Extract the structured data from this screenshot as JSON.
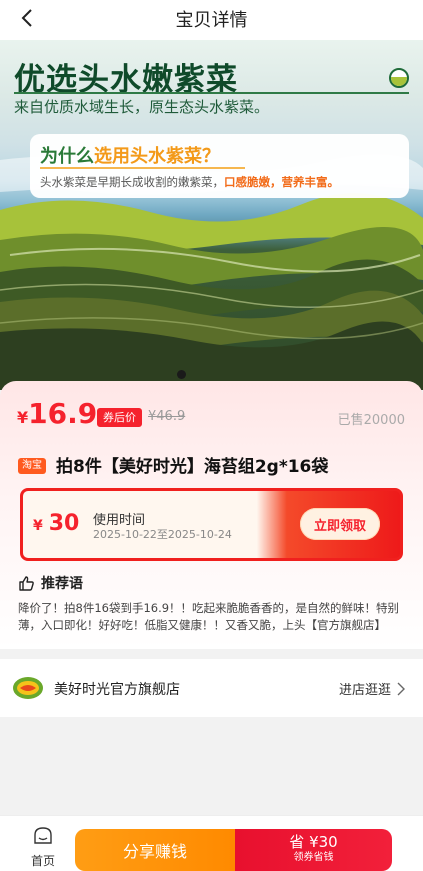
{
  "nav": {
    "title": "宝贝详情",
    "back_icon": "chevron-left-icon"
  },
  "hero": {
    "title": "优选头水嫩紫菜",
    "subtitle": "来自优质水域生长，原生态头水紫菜。",
    "question_a": "为什么",
    "question_b": "选用头水紫菜？",
    "desc_a": "头水紫菜是早期长成收割的嫩紫菜，",
    "desc_b": "口感脆嫩，营养丰富。"
  },
  "product": {
    "currency": "¥",
    "price": "16.9",
    "price_tag": "券后价",
    "original_price": "¥46.9",
    "sold": "已售20000",
    "platform_badge": "淘宝",
    "title": "拍8件【美好时光】海苔组2g*16袋"
  },
  "coupon": {
    "currency": "¥",
    "amount": "30",
    "label": "使用时间",
    "date_range": "2025-10-22至2025-10-24",
    "claim_label": "立即领取"
  },
  "recommend": {
    "heading": "推荐语",
    "text": "降价了！拍8件16袋到手16.9！！吃起来脆脆香香的，是自然的鲜味！特别薄，入口即化！好好吃！低脂又健康！！又香又脆，上头【官方旗舰店】"
  },
  "shop": {
    "name": "美好时光官方旗舰店",
    "enter_label": "进店逛逛"
  },
  "bottom_bar": {
    "home_label": "首页",
    "share_label": "分享赚钱",
    "save_label": "省 ¥30",
    "save_sub": "领券省钱"
  },
  "colors": {
    "accent_red": "#f5222d",
    "orange": "#ff8a00",
    "hero_green": "#0f4a2a"
  }
}
